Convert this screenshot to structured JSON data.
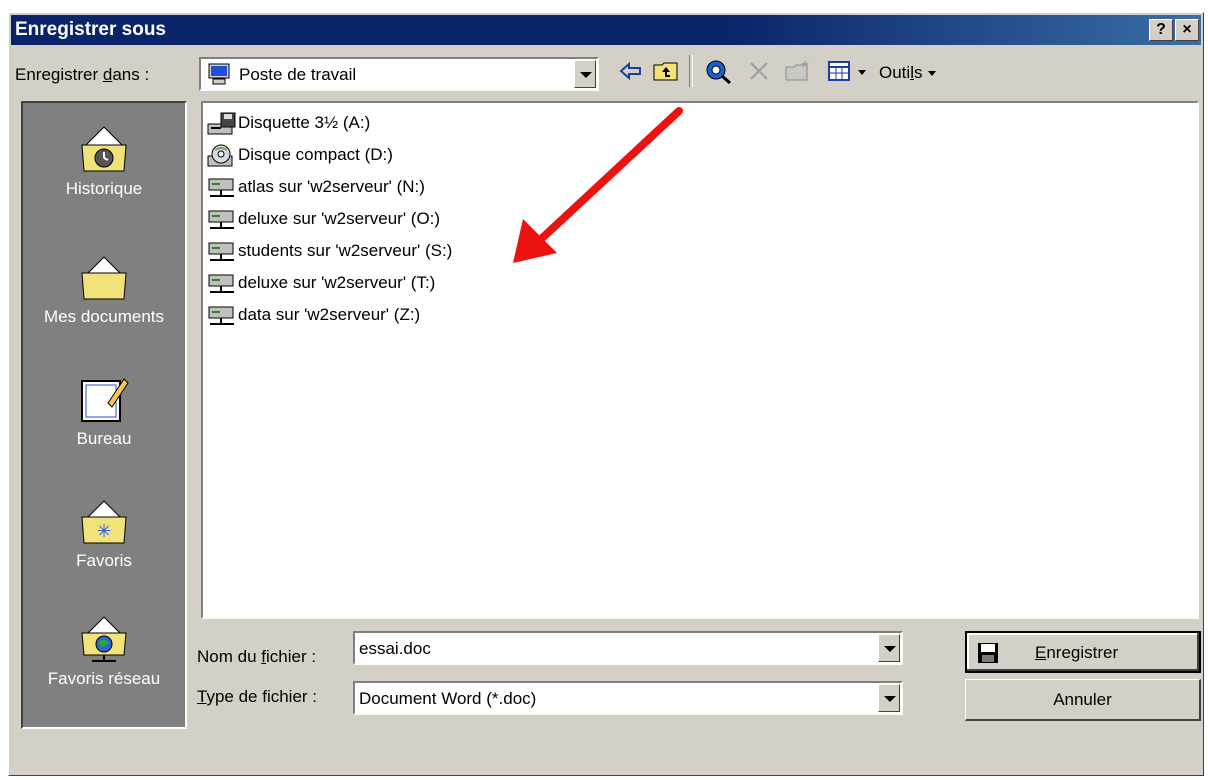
{
  "dialog": {
    "title": "Enregistrer sous",
    "help_glyph": "?",
    "close_glyph": "×"
  },
  "location": {
    "label_pre": "Enregistrer ",
    "label_ul": "d",
    "label_post": "ans :",
    "value": "Poste de travail"
  },
  "toolbar": {
    "tools_pre": "Outi",
    "tools_ul": "l",
    "tools_post": "s"
  },
  "places": [
    {
      "label": "Historique",
      "icon": "history-folder-icon"
    },
    {
      "label": "Mes documents",
      "icon": "my-documents-folder-icon"
    },
    {
      "label": "Bureau",
      "icon": "desktop-icon"
    },
    {
      "label": "Favoris",
      "icon": "favorites-folder-icon"
    },
    {
      "label": "Favoris réseau",
      "icon": "network-places-icon"
    }
  ],
  "files": [
    {
      "name": "Disquette 3½ (A:)",
      "icon": "floppy-drive-icon"
    },
    {
      "name": "Disque compact (D:)",
      "icon": "cd-drive-icon"
    },
    {
      "name": "atlas sur 'w2serveur' (N:)",
      "icon": "network-drive-icon"
    },
    {
      "name": "deluxe sur 'w2serveur' (O:)",
      "icon": "network-drive-icon"
    },
    {
      "name": "students sur 'w2serveur' (S:)",
      "icon": "network-drive-icon"
    },
    {
      "name": "deluxe sur 'w2serveur' (T:)",
      "icon": "network-drive-icon"
    },
    {
      "name": "data sur 'w2serveur' (Z:)",
      "icon": "network-drive-icon"
    }
  ],
  "filename": {
    "label_pre": "Nom du ",
    "label_ul": "f",
    "label_post": "ichier :",
    "value": "essai.doc"
  },
  "filetype": {
    "label_ul": "T",
    "label_post": "ype de fichier :",
    "value": "Document Word (*.doc)"
  },
  "buttons": {
    "save_ul": "E",
    "save_post": "nregistrer",
    "cancel": "Annuler"
  },
  "annotation": {
    "color": "#ee1111"
  },
  "colors": {
    "title_bar": "#0a246a",
    "face": "#d4d0c8",
    "places_bar": "#808080"
  }
}
